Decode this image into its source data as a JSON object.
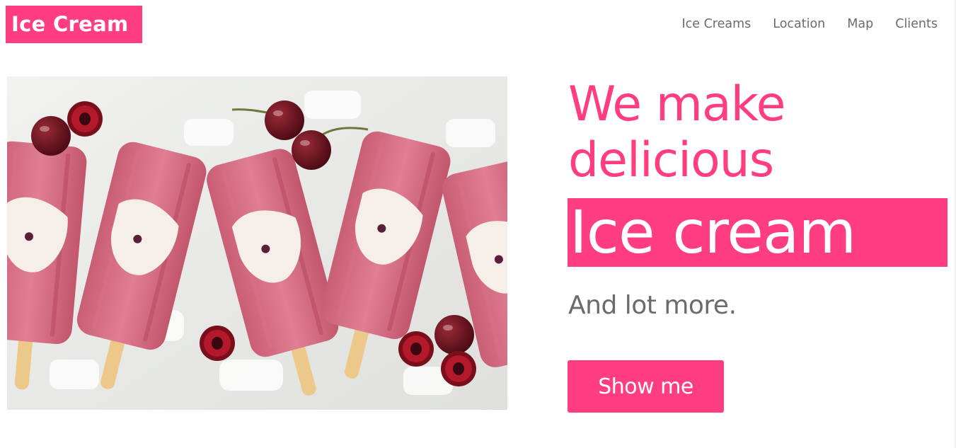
{
  "brand": {
    "logo_text": "Ice Cream"
  },
  "nav": {
    "items": [
      {
        "label": "Ice Creams"
      },
      {
        "label": "Location"
      },
      {
        "label": "Map"
      },
      {
        "label": "Clients"
      }
    ]
  },
  "hero": {
    "headline": "We make delicious",
    "highlight": "Ice cream",
    "subline": "And lot more.",
    "cta_label": "Show me",
    "image_icon": "popsicles-with-cherries-photo"
  },
  "colors": {
    "accent": "#ff3d80",
    "nav_text": "#6b6b6b",
    "subline_text": "#6b6b6b",
    "background": "#ffffff"
  }
}
